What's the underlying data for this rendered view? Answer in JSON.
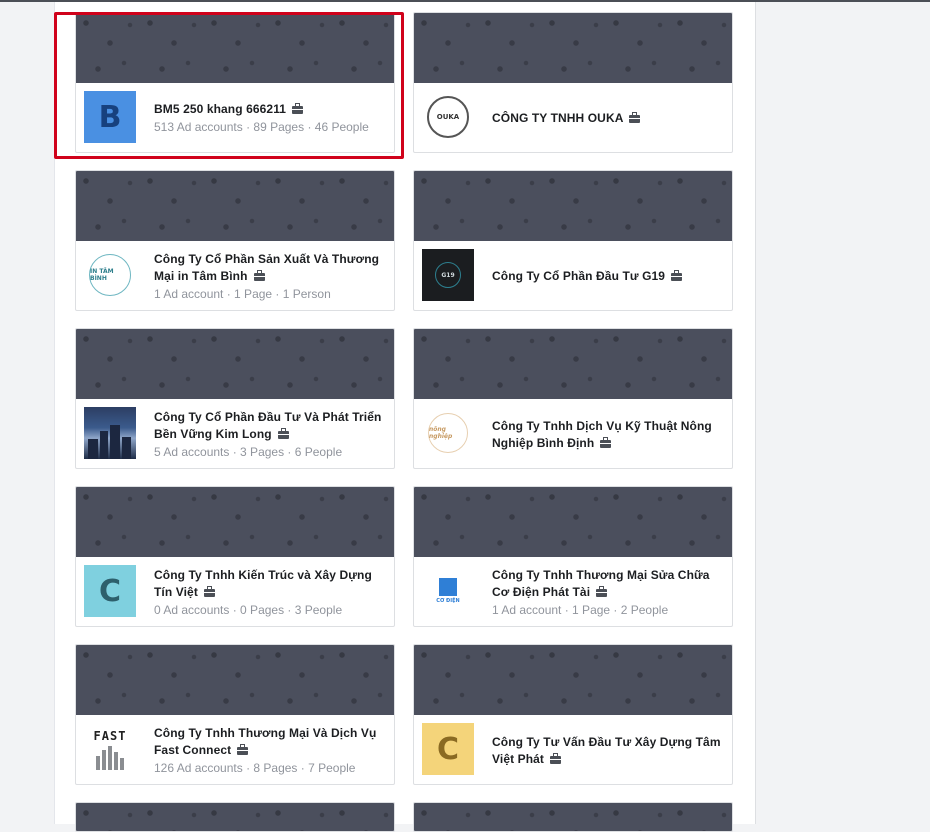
{
  "businesses": [
    {
      "name": "BM5 250 khang 666211",
      "meta": "513 Ad accounts · 89 Pages · 46 People",
      "avatar": "letter-b",
      "letter": "B",
      "avatar_text": ""
    },
    {
      "name": "CÔNG TY TNHH OUKA",
      "meta": "",
      "avatar": "logo-circle-dark",
      "letter": "",
      "avatar_text": "OUKA"
    },
    {
      "name": "Công Ty Cổ Phần Sản Xuất Và Thương Mại in Tâm Bình",
      "meta": "1 Ad account · 1 Page · 1 Person",
      "avatar": "logo-circle-teal",
      "letter": "",
      "avatar_text": "IN TÂM BÌNH"
    },
    {
      "name": "Công Ty Cổ Phần Đầu Tư G19",
      "meta": "",
      "avatar": "logo-g19",
      "letter": "",
      "avatar_text": "G19"
    },
    {
      "name": "Công Ty Cổ Phần Đầu Tư Và Phát Triển Bền Vững Kim Long",
      "meta": "5 Ad accounts · 3 Pages · 6 People",
      "avatar": "logo-photo",
      "letter": "",
      "avatar_text": ""
    },
    {
      "name": "Công Ty Tnhh Dịch Vụ Kỹ Thuật Nông Nghiệp Bình Định",
      "meta": "",
      "avatar": "logo-cream",
      "letter": "",
      "avatar_text": "nông nghiệp"
    },
    {
      "name": "Công Ty Tnhh Kiến Trúc và Xây Dựng Tín Việt",
      "meta": "0 Ad accounts · 0 Pages · 3 People",
      "avatar": "letter-c1",
      "letter": "C",
      "avatar_text": ""
    },
    {
      "name": "Công Ty Tnhh Thương Mại Sửa Chữa Cơ Điện Phát Tài",
      "meta": "1 Ad account · 1 Page · 2 People",
      "avatar": "logo-codien",
      "letter": "",
      "avatar_text": "CƠ ĐIỆN"
    },
    {
      "name": "Công Ty Tnhh Thương Mại Và Dịch Vụ Fast Connect",
      "meta": "126 Ad accounts · 8 Pages · 7 People",
      "avatar": "logo-fast",
      "letter": "",
      "avatar_text": "FAST"
    },
    {
      "name": "Công Ty Tư Vấn Đầu Tư Xây Dựng Tâm Việt Phát",
      "meta": "",
      "avatar": "letter-c2",
      "letter": "C",
      "avatar_text": ""
    }
  ],
  "colors": {
    "highlight": "#d0021b",
    "cover": "#4b4f5d"
  }
}
